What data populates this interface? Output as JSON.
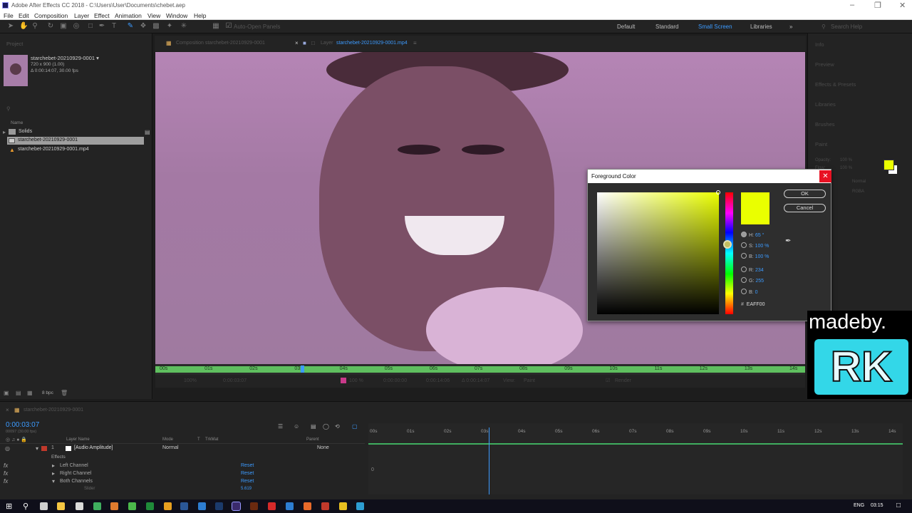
{
  "window": {
    "title": "Adobe After Effects CC 2018 - C:\\Users\\User\\Documents\\chebet.aep"
  },
  "menu": [
    "File",
    "Edit",
    "Composition",
    "Layer",
    "Effect",
    "Animation",
    "View",
    "Window",
    "Help"
  ],
  "toolbar": {
    "auto_open": "Auto-Open Panels",
    "workspaces": [
      "Default",
      "Standard",
      "Small Screen",
      "Libraries"
    ],
    "active_workspace": "Small Screen",
    "search_placeholder": "Search Help"
  },
  "project": {
    "header": "Project",
    "item_name": "starchebet-20210929-0001 ▾",
    "item_dims": "720 x 900 (1.00)",
    "item_dur": "Δ 0:00:14:07, 30.00 fps",
    "col_name": "Name",
    "items": [
      "Solids",
      "starchebet-20210929-0001",
      "starchebet-20210929-0001.mp4"
    ],
    "bpc": "8 bpc"
  },
  "viewer": {
    "tab_comp": "Composition starchebet-20210929-0001",
    "tab_layer_prefix": "Layer",
    "tab_layer": "starchebet-20210929-0001.mp4",
    "ticks": [
      "00s",
      "01s",
      "02s",
      "03s",
      "04s",
      "05s",
      "06s",
      "07s",
      "08s",
      "09s",
      "10s",
      "11s",
      "12s",
      "13s",
      "14s"
    ],
    "playhead_fraction": 0.22,
    "foot": [
      "100%",
      "0:00:03:07",
      "100 %",
      "0:00:00:00",
      "0:00:14:06",
      "Δ 0:00:14:07",
      "View:",
      "Paint",
      "Render"
    ]
  },
  "right_panel": [
    "Info",
    "Preview",
    "Effects & Presets",
    "Libraries",
    "Brushes",
    "Paint"
  ],
  "paint": {
    "opacity": "Opacity:",
    "opacity_val": "100 %",
    "flow": "Flow:",
    "flow_val": "100 %",
    "mode": "Normal",
    "channels": "RGBA",
    "fg_color": "#eaff00"
  },
  "dialog": {
    "title": "Foreground Color",
    "ok": "OK",
    "cancel": "Cancel",
    "h": "65 °",
    "s": "100 %",
    "b": "100 %",
    "r": "234",
    "g": "255",
    "bl": "0",
    "hex": "EAFF00",
    "color": "#eaff00"
  },
  "timeline": {
    "comp_tab": "starchebet-20210929-0001",
    "timecode": "0:00:03:07",
    "frames": "00097 (30.00 fps)",
    "col_layer": "Layer Name",
    "col_mode": "Mode",
    "col_t": "T",
    "col_trkmat": "TrkMat",
    "col_parent": "Parent",
    "layer_num": "1",
    "layer_name": "[Audio Amplitude]",
    "layer_mode": "Normal",
    "layer_parent": "None",
    "effects": "Effects",
    "channels": [
      "Left Channel",
      "Right Channel",
      "Both Channels"
    ],
    "reset": "Reset",
    "slider": "Slider",
    "slider_val": "5.619",
    "ticks": [
      "00s",
      "01s",
      "02s",
      "03s",
      "04s",
      "05s",
      "06s",
      "07s",
      "08s",
      "09s",
      "10s",
      "11s",
      "12s",
      "13s",
      "14s"
    ],
    "graph_zero": "0",
    "playhead_fraction": 0.225
  },
  "taskbar": {
    "lang": "ENG",
    "time": "03:15"
  },
  "watermark": {
    "line1": "madeby.",
    "line2": "RK"
  }
}
